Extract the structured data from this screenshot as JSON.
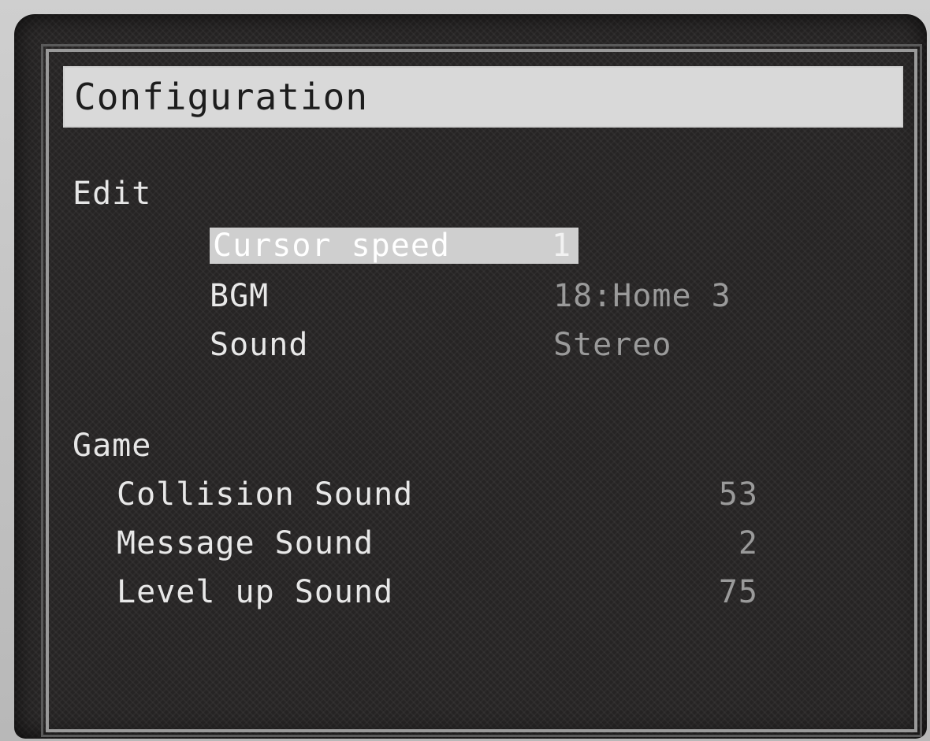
{
  "window": {
    "title": "Configuration"
  },
  "edit": {
    "heading": "Edit",
    "items": [
      {
        "label": "Cursor speed",
        "value": "1"
      },
      {
        "label": "BGM",
        "value": "18:Home 3"
      },
      {
        "label": "Sound",
        "value": "Stereo"
      }
    ]
  },
  "game": {
    "heading": "Game",
    "items": [
      {
        "label": "Collision Sound",
        "value": "53"
      },
      {
        "label": "Message Sound",
        "value": "2"
      },
      {
        "label": "Level up Sound",
        "value": "75"
      }
    ]
  },
  "colors": {
    "panel_background": "#262424",
    "title_bar": "#d9d9d9",
    "highlight": "#cfcfcf",
    "text": "#e8e8e8",
    "muted_value": "#9a9a9a"
  }
}
